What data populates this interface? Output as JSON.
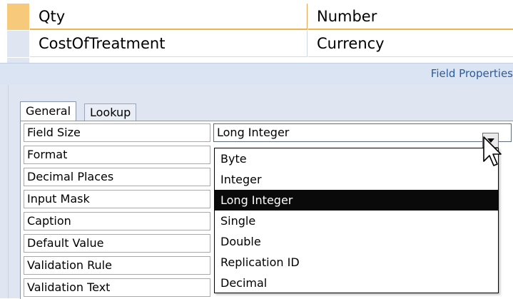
{
  "table_design": {
    "rows": [
      {
        "field_name": "Qty",
        "data_type": "Number",
        "selected": true
      },
      {
        "field_name": "CostOfTreatment",
        "data_type": "Currency",
        "selected": false
      }
    ]
  },
  "field_properties": {
    "title": "Field Properties",
    "tabs": [
      {
        "label": "General",
        "active": true
      },
      {
        "label": "Lookup",
        "active": false
      }
    ],
    "properties": [
      {
        "label": "Field Size",
        "value": "Long Integer"
      },
      {
        "label": "Format",
        "value": ""
      },
      {
        "label": "Decimal Places",
        "value": ""
      },
      {
        "label": "Input Mask",
        "value": ""
      },
      {
        "label": "Caption",
        "value": ""
      },
      {
        "label": "Default Value",
        "value": ""
      },
      {
        "label": "Validation Rule",
        "value": ""
      },
      {
        "label": "Validation Text",
        "value": ""
      }
    ],
    "field_size_dropdown": {
      "selected": "Long Integer",
      "options": [
        "Byte",
        "Integer",
        "Long Integer",
        "Single",
        "Double",
        "Replication ID",
        "Decimal"
      ]
    }
  },
  "icons": {
    "dropdown_arrow": "chevron-down-icon",
    "cursor": "mouse-pointer-icon"
  },
  "colors": {
    "selected_row_selector": "#f7c97a",
    "selected_row_border": "#f0b24e",
    "panel_background": "#dfe6f1",
    "panel_title": "#2c5b9a",
    "dropdown_highlight": "#0a0a0a"
  }
}
